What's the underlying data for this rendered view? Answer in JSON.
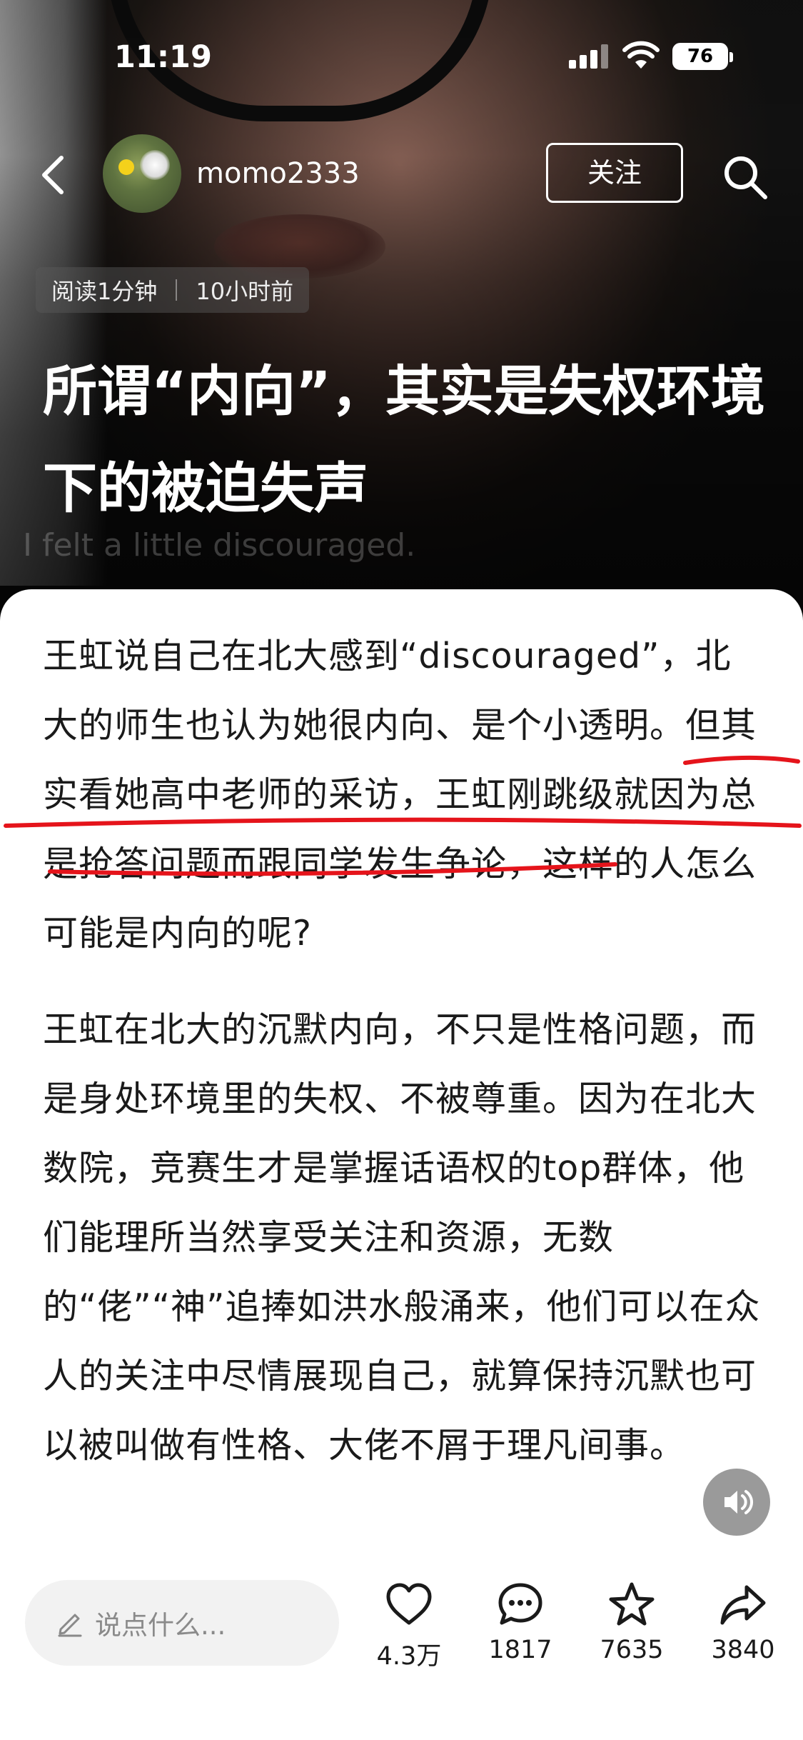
{
  "status_bar": {
    "time": "11:19",
    "battery": "76"
  },
  "header": {
    "username": "momo2333",
    "follow_label": "关注"
  },
  "article": {
    "read_time": "阅读1分钟",
    "posted_ago": "10小时前",
    "title": "所谓“内向”，其实是失权环境下的被迫失声",
    "video_subtitle": "I felt a little discouraged.",
    "paragraph_1": "王虹说自己在北大感到“discouraged”，北大的师生也认为她很内向、是个小透明。但其实看她高中老师的采访，王虹刚跳级就因为总是抢答问题而跟同学发生争论，这样的人怎么可能是内向的呢?",
    "paragraph_2": "王虹在北大的沉默内向，不只是性格问题，而是身处环境里的失权、不被尊重。因为在北大数院，竞赛生才是掌握话语权的top群体，他们能理所当然享受关注和资源，无数的“佬”“神”追捧如洪水般涌来，他们可以在众人的关注中尽情展现自己，就算保持沉默也可以被叫做有性格、大佬不屑于理凡间事。"
  },
  "bottom_bar": {
    "comment_placeholder": "说点什么...",
    "likes": "4.3万",
    "comments": "1817",
    "favorites": "7635",
    "shares": "3840"
  },
  "colors": {
    "annotation_red": "#e5141b",
    "text": "#1a1a1a"
  }
}
